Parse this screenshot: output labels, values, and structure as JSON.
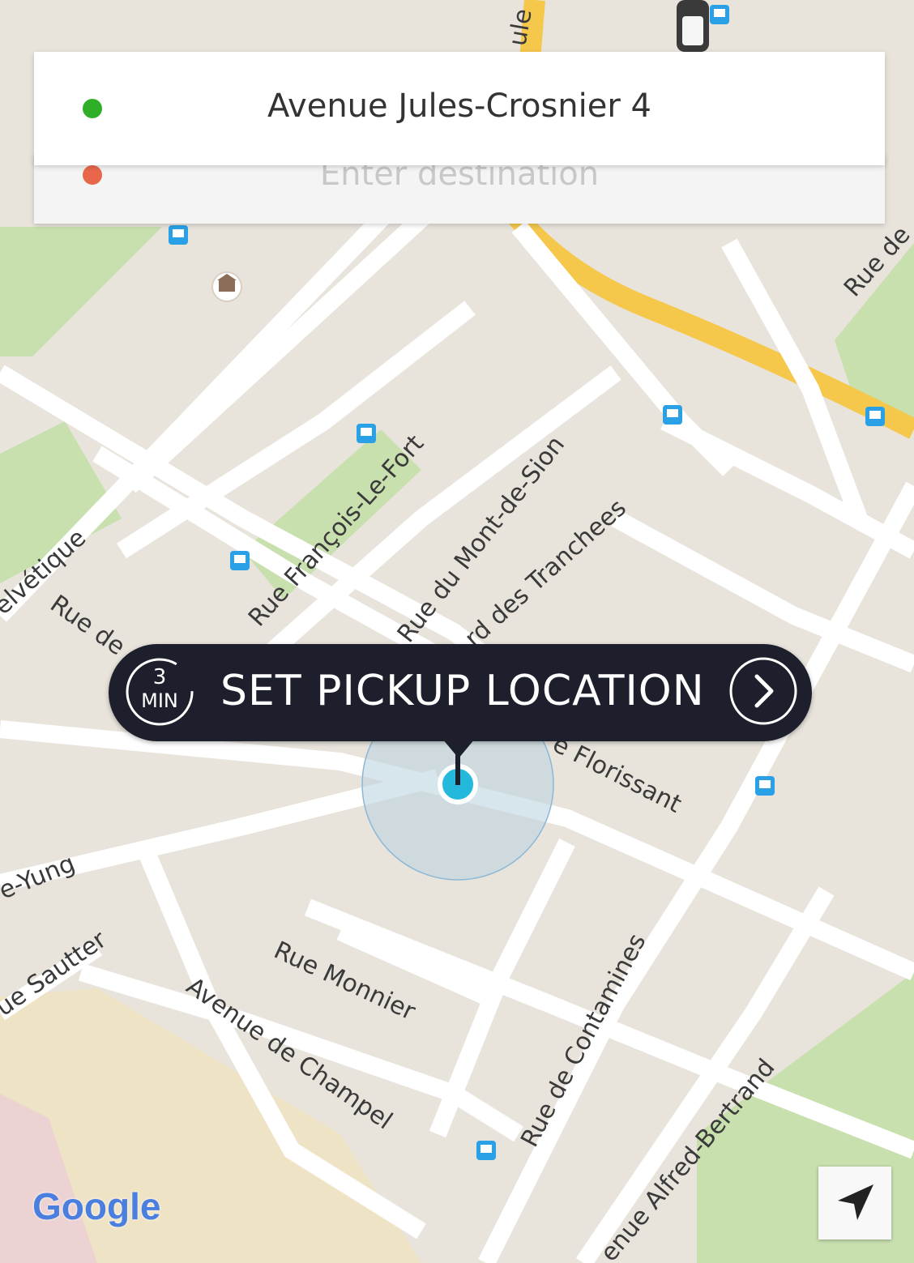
{
  "search": {
    "pickup_value": "Avenue Jules-Crosnier 4",
    "destination_placeholder": "Enter destination"
  },
  "pickup_button": {
    "eta_number": "3",
    "eta_unit": "MIN",
    "label": "SET PICKUP LOCATION"
  },
  "map": {
    "streets": [
      "Rue François-Le-Fort",
      "Rue du Mont-de-Sion",
      "rd des Tranchees",
      "elvétique",
      "Rue de",
      "e Florissant",
      "e-Yung",
      "ue Sautter",
      "Rue Monnier",
      "Avenue de Champel",
      "Rue de Contamines",
      "enue Alfred-Bertrand",
      "Rue de",
      "ule"
    ],
    "colors": {
      "road": "#ffffff",
      "major_road": "#f5c84c",
      "park": "#c8dfae",
      "background": "#e8e4dc",
      "bus_stop": "#2aa0e6",
      "pickup_dot": "#2fae27",
      "destination_dot": "#e8674a",
      "location_dot": "#24b8dc"
    },
    "logo": "Google",
    "icons": [
      "bus-stop-icon",
      "museum-icon",
      "car-icon",
      "navigation-arrow-icon"
    ]
  }
}
